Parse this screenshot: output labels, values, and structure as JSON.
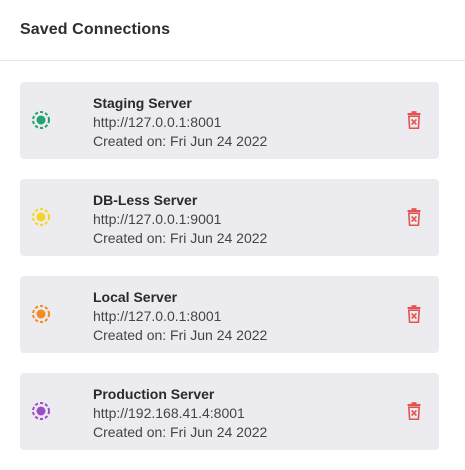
{
  "header": {
    "title": "Saved Connections"
  },
  "connections": [
    {
      "name": "Staging Server",
      "url": "http://127.0.0.1:8001",
      "created": "Created on: Fri Jun 24 2022",
      "color": "#23a46f",
      "status_icon": "connection-status-icon",
      "delete_icon": "trash-icon"
    },
    {
      "name": "DB-Less Server",
      "url": "http://127.0.0.1:9001",
      "created": "Created on: Fri Jun 24 2022",
      "color": "#f5d327",
      "status_icon": "connection-status-icon",
      "delete_icon": "trash-icon"
    },
    {
      "name": "Local Server",
      "url": "http://127.0.0.1:8001",
      "created": "Created on: Fri Jun 24 2022",
      "color": "#f48a20",
      "status_icon": "connection-status-icon",
      "delete_icon": "trash-icon"
    },
    {
      "name": "Production Server",
      "url": "http://192.168.41.4:8001",
      "created": "Created on: Fri Jun 24 2022",
      "color": "#9b4fc6",
      "status_icon": "connection-status-icon",
      "delete_icon": "trash-icon"
    }
  ],
  "colors": {
    "delete": "#e5524f",
    "card_bg": "#ececf0"
  }
}
